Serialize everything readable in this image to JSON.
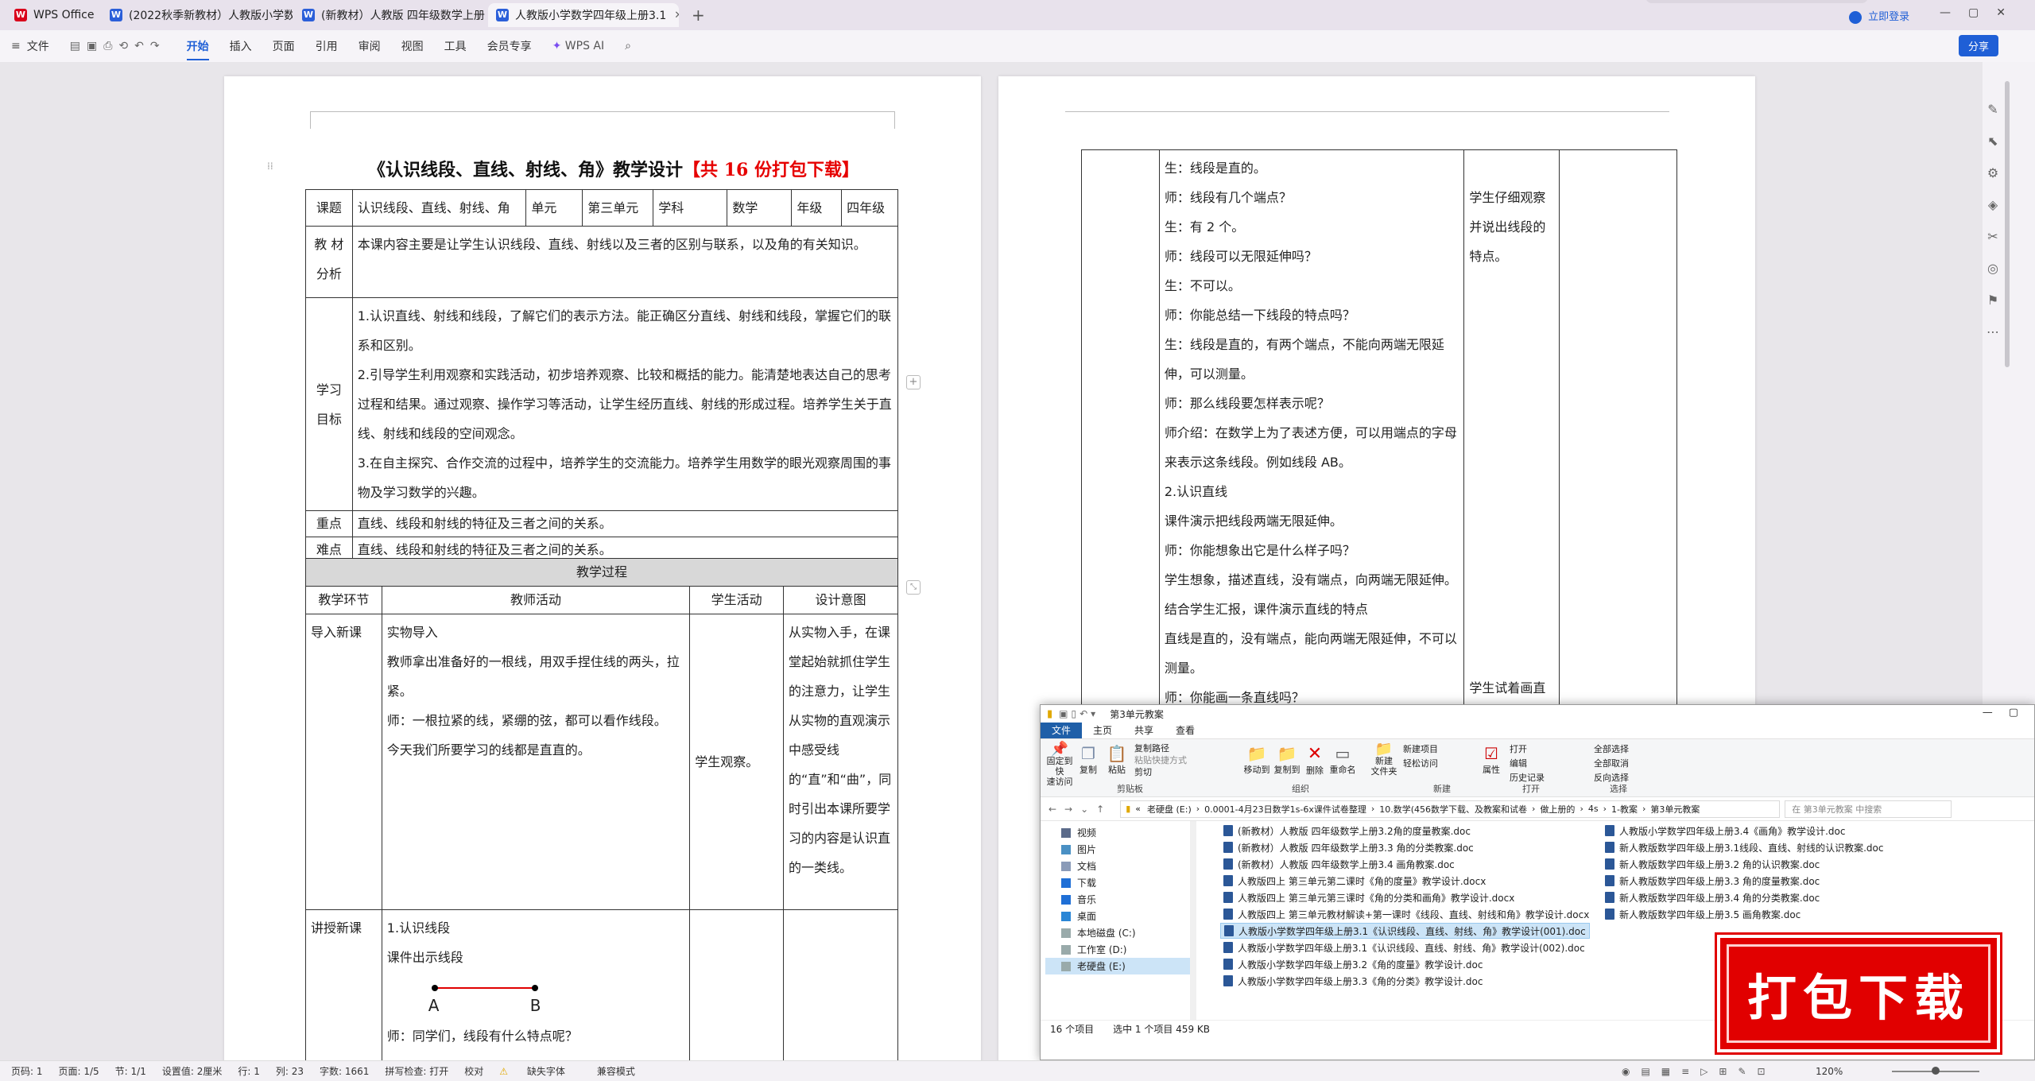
{
  "app": {
    "tabs": [
      {
        "label": "WPS Office",
        "icon": "wps-logo-icon",
        "color": "#d9001b"
      },
      {
        "label": "(2022秋季新教材）人教版小学数",
        "icon": "word-doc-icon",
        "color": "#2b5fd9"
      },
      {
        "label": "(新教材）人教版 四年级数学上册",
        "icon": "word-doc-icon",
        "color": "#2b5fd9"
      },
      {
        "label": "人教版小学数学四年级上册3.1",
        "icon": "word-doc-icon",
        "color": "#2b5fd9"
      }
    ],
    "login": "立即登录",
    "share": "分享"
  },
  "ribbon": {
    "file": "文件",
    "menus": [
      "开始",
      "插入",
      "页面",
      "引用",
      "审阅",
      "视图",
      "工具",
      "会员专享"
    ],
    "ai": "WPS AI"
  },
  "doc": {
    "title": "《认识线段、直线、射线、角》教学设计",
    "title_red": "【共 16 份打包下载】",
    "row1": [
      "课题",
      "认识线段、直线、射线、角",
      "单元",
      "第三单元",
      "学科",
      "数学",
      "年级",
      "四年级"
    ],
    "analysis_label": "教 材\n分析",
    "analysis": "本课内容主要是让学生认识线段、直线、射线以及三者的区别与联系，以及角的有关知识。",
    "goal_label": "学习\n目标",
    "goals": [
      "1.认识直线、射线和线段，了解它们的表示方法。能正确区分直线、射线和线段，掌握它们的联系和区别。",
      "2.引导学生利用观察和实践活动，初步培养观察、比较和概括的能力。能清楚地表达自己的思考过程和结果。通过观察、操作学习等活动，让学生经历直线、射线的形成过程。培养学生关于直线、射线和线段的空间观念。",
      "3.在自主探究、合作交流的过程中，培养学生的交流能力。培养学生用数学的眼光观察周围的事物及学习数学的兴趣。"
    ],
    "key_label": "重点",
    "key": "直线、线段和射线的特征及三者之间的关系。",
    "diff_label": "难点",
    "diff": "直线、线段和射线的特征及三者之间的关系。",
    "process_label": "教学过程",
    "headers": [
      "教学环节",
      "教师活动",
      "学生活动",
      "设计意图"
    ],
    "stage1": "导入新课",
    "stage1_teacher": "实物导入\n教师拿出准备好的一根线，用双手捏住线的两头，拉紧。\n师：一根拉紧的线，紧绷的弦，都可以看作线段。\n今天我们所要学习的线都是直直的。",
    "stage1_student": "学生观察。",
    "stage1_intent": "从实物入手，在课堂起始就抓住学生的注意力，让学生从实物的直观演示中感受线的“直”和“曲”，同时引出本课所要学习的内容是认识直的一类线。",
    "stage2": "讲授新课",
    "stage2_teacher": "1.认识线段\n课件出示线段",
    "point_a": "A",
    "point_b": "B",
    "stage2_q": "师：同学们，线段有什么特点呢？"
  },
  "page2": {
    "lines": [
      "生：线段是直的。",
      "师：线段有几个端点？",
      "生：有 2 个。",
      "师：线段可以无限延伸吗？",
      "生：不可以。",
      "师：你能总结一下线段的特点吗？",
      "生：线段是直的，有两个端点，不能向两端无限延伸，可以测量。",
      "师：那么线段要怎样表示呢？",
      "师介绍：在数学上为了表述方便，可以用端点的字母来表示这条线段。例如线段 AB。",
      "2.认识直线",
      "课件演示把线段两端无限延伸。",
      "师：你能想象出它是什么样子吗？",
      "学生想象，描述直线，没有端点，向两端无限延伸。结合学生汇报，课件演示直线的特点",
      "直线是直的，没有端点，能向两端无限延伸，不可以测量。",
      "师：你能画一条直线吗？"
    ],
    "student1": "学生仔细观察并说出线段的特点。",
    "student2": "学生试着画直"
  },
  "explorer": {
    "title": "第3单元教案",
    "tabs": [
      "文件",
      "主页",
      "共享",
      "查看"
    ],
    "ribbon": {
      "pin": "固定到快\n速访问",
      "copy": "复制",
      "paste": "粘贴",
      "copy_path": "复制路径",
      "paste_shortcut": "粘贴快捷方式",
      "cut": "剪切",
      "clipboard": "剪贴板",
      "move_to": "移动到",
      "copy_to": "复制到",
      "delete": "删除",
      "rename": "重命名",
      "organize": "组织",
      "new_folder": "新建\n文件夹",
      "new_item": "新建项目",
      "easy_access": "轻松访问",
      "new": "新建",
      "properties": "属性",
      "open": "打开",
      "edit": "编辑",
      "history": "历史记录",
      "open_group": "打开",
      "select_all": "全部选择",
      "select_none": "全部取消",
      "invert": "反向选择",
      "select": "选择"
    },
    "breadcrumb": [
      "老硬盘 (E:)",
      "0.0001-4月23日数学1s-6x课件试卷整理",
      "10.数学(456数学下载、及教案和试卷",
      "做上册的",
      "4s",
      "1-教案",
      "第3单元教案"
    ],
    "search_placeholder": "在 第3单元教案 中搜索",
    "nav": [
      "视频",
      "图片",
      "文档",
      "下载",
      "音乐",
      "桌面",
      "本地磁盘 (C:)",
      "工作室 (D:)",
      "老硬盘 (E:)"
    ],
    "files_col1": [
      "(新教材）人教版 四年级数学上册3.2角的度量教案.doc",
      "(新教材）人教版 四年级数学上册3.3  角的分类教案.doc",
      "(新教材）人教版 四年级数学上册3.4  画角教案.doc",
      "人教版四上 第三单元第二课时《角的度量》教学设计.docx",
      "人教版四上 第三单元第三课时《角的分类和画角》教学设计.docx",
      "人教版四上 第三单元教材解读+第一课时《线段、直线、射线和角》教学设计.docx",
      "人教版小学数学四年级上册3.1《认识线段、直线、射线、角》教学设计(001).doc",
      "人教版小学数学四年级上册3.1《认识线段、直线、射线、角》教学设计(002).doc",
      "人教版小学数学四年级上册3.2《角的度量》教学设计.doc",
      "人教版小学数学四年级上册3.3《角的分类》教学设计.doc"
    ],
    "files_col2": [
      "人教版小学数学四年级上册3.4《画角》教学设计.doc",
      "新人教版数学四年级上册3.1线段、直线、射线的认识教案.doc",
      "新人教版数学四年级上册3.2 角的认识教案.doc",
      "新人教版数学四年级上册3.3 角的度量教案.doc",
      "新人教版数学四年级上册3.4 角的分类教案.doc",
      "新人教版数学四年级上册3.5 画角教案.doc"
    ],
    "status_count": "16 个项目",
    "status_selected": "选中 1 个项目  459 KB"
  },
  "stamp": "打包下载",
  "status": [
    "页码: 1",
    "页面: 1/5",
    "节: 1/1",
    "设置值: 2厘米",
    "行: 1",
    "列: 23",
    "字数: 1661",
    "拼写检查: 打开",
    "校对",
    "缺失字体",
    "兼容模式"
  ],
  "zoom": "120%"
}
